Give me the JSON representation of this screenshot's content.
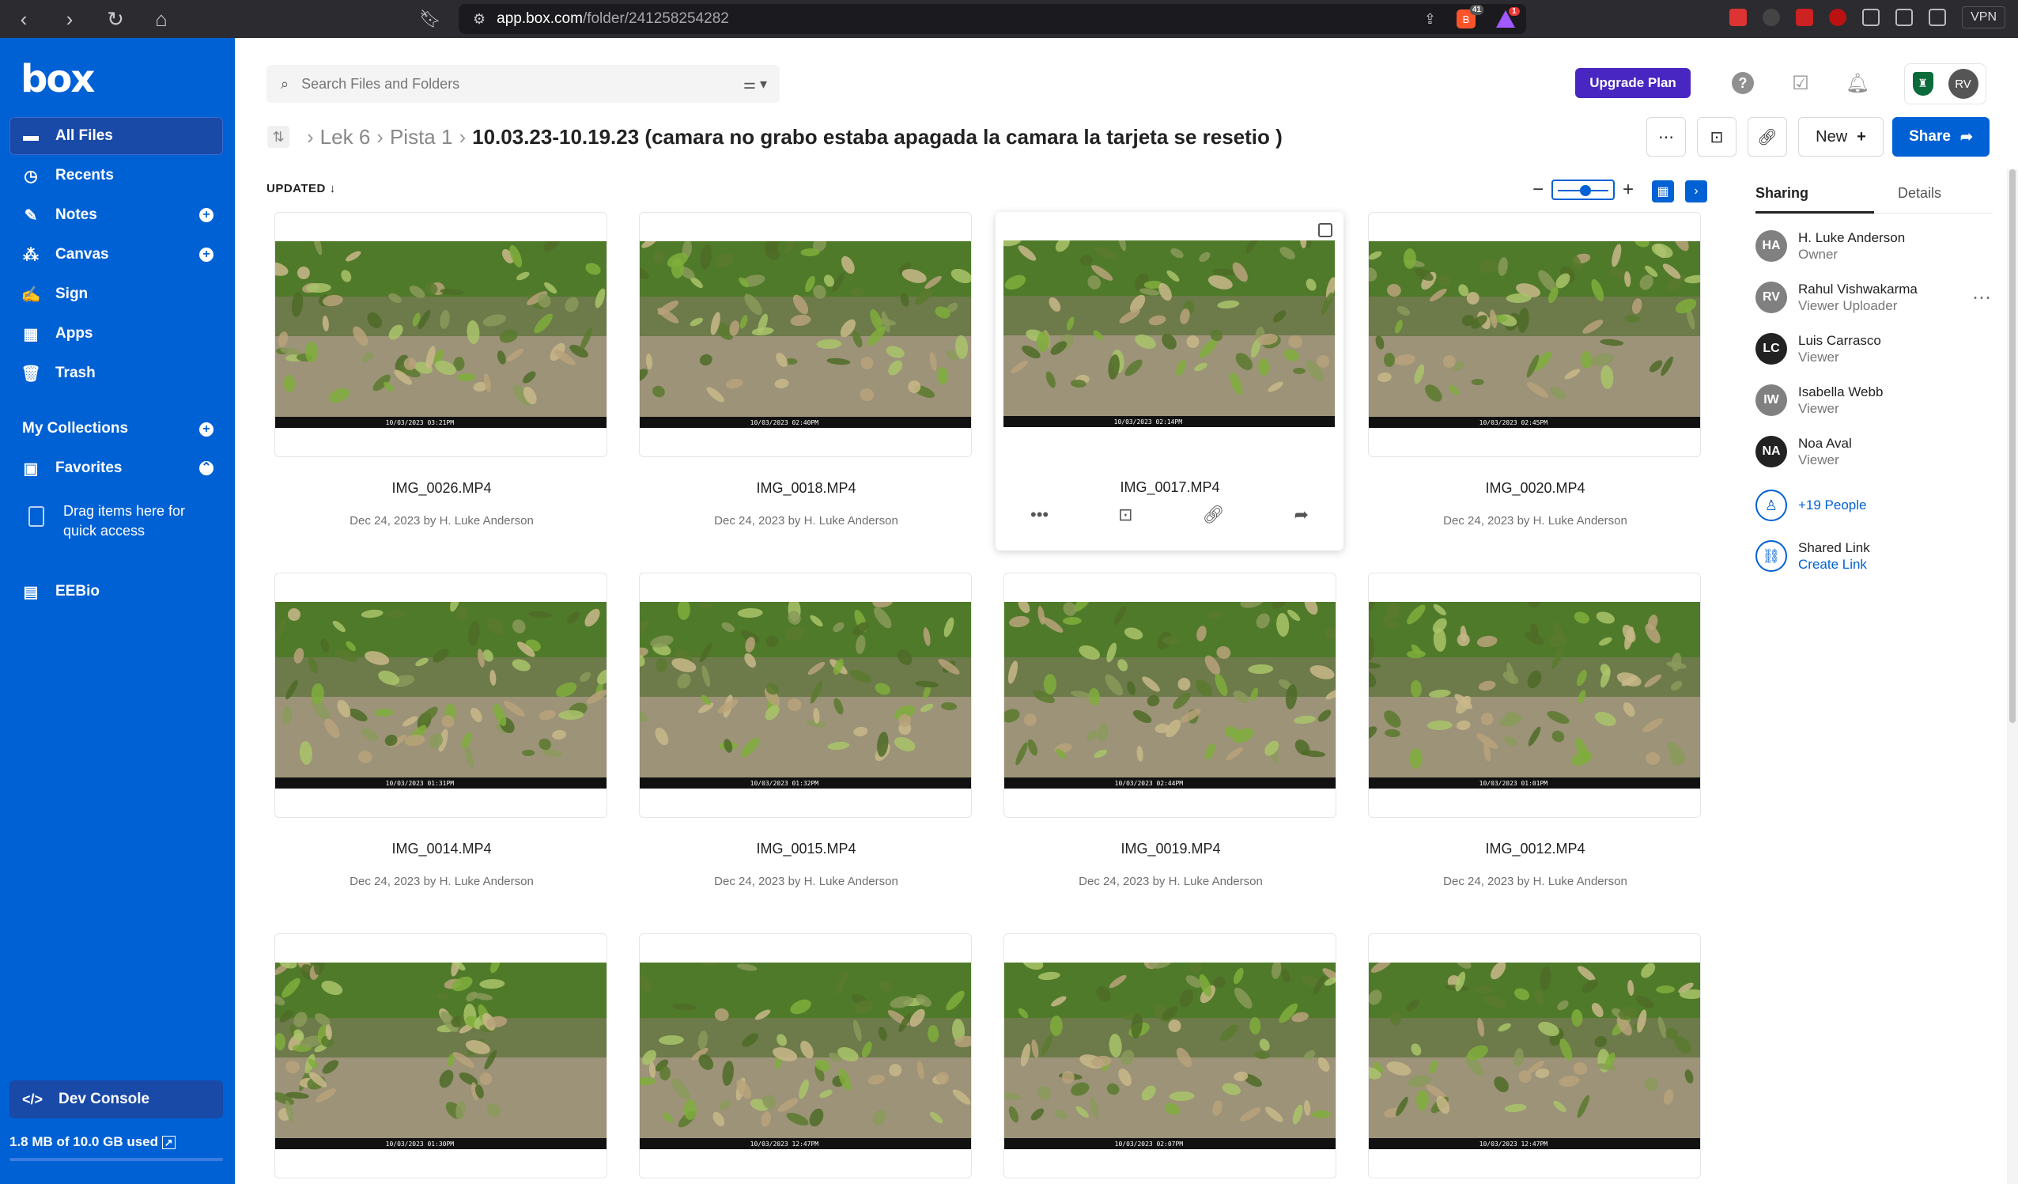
{
  "browser": {
    "url_host": "app.box.com",
    "url_path": "/folder/241258254282",
    "brave_badge": "41",
    "alert_badge": "1",
    "vpn_label": "VPN"
  },
  "sidebar": {
    "logo": "box",
    "items": [
      {
        "label": "All Files",
        "icon": "folder-icon"
      },
      {
        "label": "Recents",
        "icon": "clock-icon"
      },
      {
        "label": "Notes",
        "icon": "notes-icon"
      },
      {
        "label": "Canvas",
        "icon": "canvas-icon"
      },
      {
        "label": "Sign",
        "icon": "sign-icon"
      },
      {
        "label": "Apps",
        "icon": "apps-grid-icon"
      },
      {
        "label": "Trash",
        "icon": "trash-icon"
      }
    ],
    "my_collections": "My Collections",
    "favorites": "Favorites",
    "drag_hint": "Drag items here for quick access",
    "eebio": "EEBio",
    "dev_console": "Dev Console",
    "storage": "1.8 MB of 10.0 GB used"
  },
  "header": {
    "search_placeholder": "Search Files and Folders",
    "upgrade": "Upgrade Plan",
    "avatar": "RV"
  },
  "breadcrumb": {
    "items": [
      "Lek 6",
      "Pista 1"
    ],
    "current": "10.03.23-10.19.23 (camara no grabo estaba apagada la camara la tarjeta se resetio )"
  },
  "actions": {
    "new": "New",
    "share": "Share"
  },
  "sort": {
    "label": "UPDATED"
  },
  "files": [
    {
      "name": "IMG_0026.MP4",
      "meta": "Dec 24, 2023 by H. Luke Anderson",
      "stamp": "10/03/2023  03:21PM"
    },
    {
      "name": "IMG_0018.MP4",
      "meta": "Dec 24, 2023 by H. Luke Anderson",
      "stamp": "10/03/2023  02:40PM"
    },
    {
      "name": "IMG_0017.MP4",
      "meta": "",
      "stamp": "10/03/2023  02:14PM"
    },
    {
      "name": "IMG_0020.MP4",
      "meta": "Dec 24, 2023 by H. Luke Anderson",
      "stamp": "10/03/2023  02:45PM"
    },
    {
      "name": "IMG_0014.MP4",
      "meta": "Dec 24, 2023 by H. Luke Anderson",
      "stamp": "10/03/2023  01:31PM"
    },
    {
      "name": "IMG_0015.MP4",
      "meta": "Dec 24, 2023 by H. Luke Anderson",
      "stamp": "10/03/2023  01:32PM"
    },
    {
      "name": "IMG_0019.MP4",
      "meta": "Dec 24, 2023 by H. Luke Anderson",
      "stamp": "10/03/2023  02:44PM"
    },
    {
      "name": "IMG_0012.MP4",
      "meta": "Dec 24, 2023 by H. Luke Anderson",
      "stamp": "10/03/2023  01:01PM"
    },
    {
      "name": "",
      "meta": "",
      "stamp": "10/03/2023  01:30PM"
    },
    {
      "name": "",
      "meta": "",
      "stamp": "10/03/2023  12:47PM"
    },
    {
      "name": "",
      "meta": "",
      "stamp": "10/03/2023  02:07PM"
    },
    {
      "name": "",
      "meta": "",
      "stamp": "10/03/2023  12:47PM"
    }
  ],
  "panel": {
    "tabs": [
      "Sharing",
      "Details"
    ],
    "people": [
      {
        "initials": "HA",
        "name": "H. Luke Anderson",
        "role": "Owner"
      },
      {
        "initials": "RV",
        "name": "Rahul Vishwakarma",
        "role": "Viewer Uploader"
      },
      {
        "initials": "LC",
        "name": "Luis Carrasco",
        "role": "Viewer"
      },
      {
        "initials": "IW",
        "name": "Isabella Webb",
        "role": "Viewer"
      },
      {
        "initials": "NA",
        "name": "Noa Aval",
        "role": "Viewer"
      }
    ],
    "more_people": "+19 People",
    "shared_link": "Shared Link",
    "create_link": "Create Link"
  }
}
